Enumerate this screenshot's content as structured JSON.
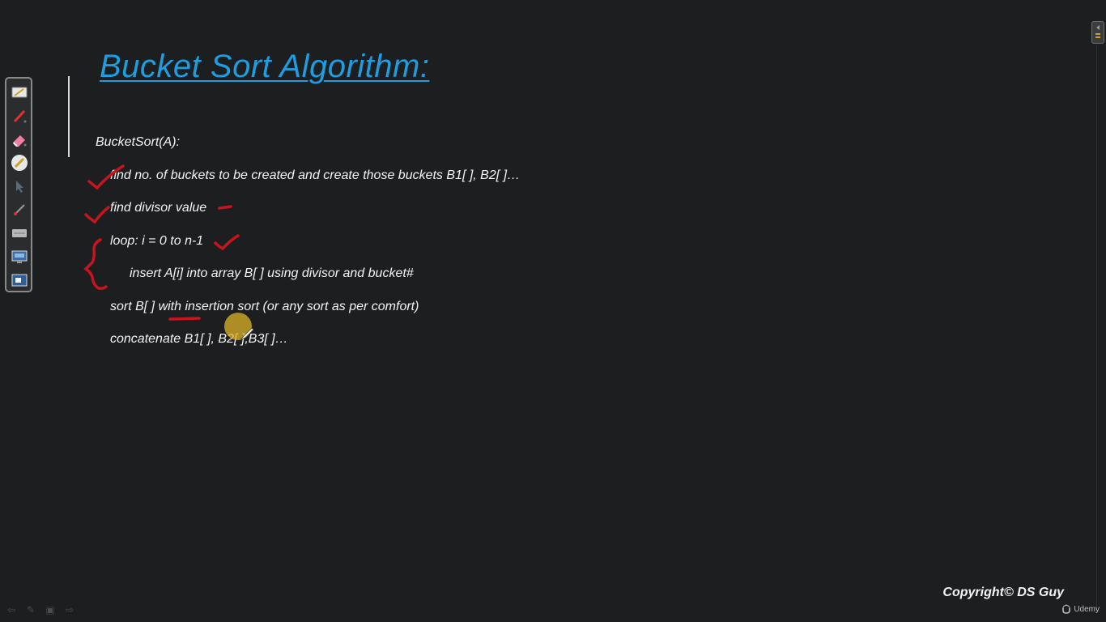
{
  "slide": {
    "title": "Bucket Sort Algorithm:",
    "lines": [
      "BucketSort(A):",
      "find no. of buckets to be created and create those buckets B1[ ], B2[ ]…",
      "find divisor value",
      "loop: i = 0 to n-1",
      "insert A[i] into array B[ ] using divisor and bucket#",
      "sort B[ ] with insertion sort (or any sort as per comfort)",
      "concatenate B1[ ], B2[ ],B3[ ]…"
    ]
  },
  "toolbar": {
    "tools": [
      "pen-tray-icon",
      "red-pen-icon",
      "eraser-icon",
      "highlighter-icon",
      "pointer-arrow-icon",
      "brush-icon",
      "keyboard-icon",
      "screen-icon",
      "presentation-icon"
    ]
  },
  "footer": {
    "copyright": "Copyright© DS Guy",
    "brand": "Udemy"
  },
  "colors": {
    "background": "#1c1e1f",
    "title": "#1e9de0",
    "text": "#f4f4f4",
    "annotation": "#c8141e",
    "highlight": "#dcb428"
  }
}
